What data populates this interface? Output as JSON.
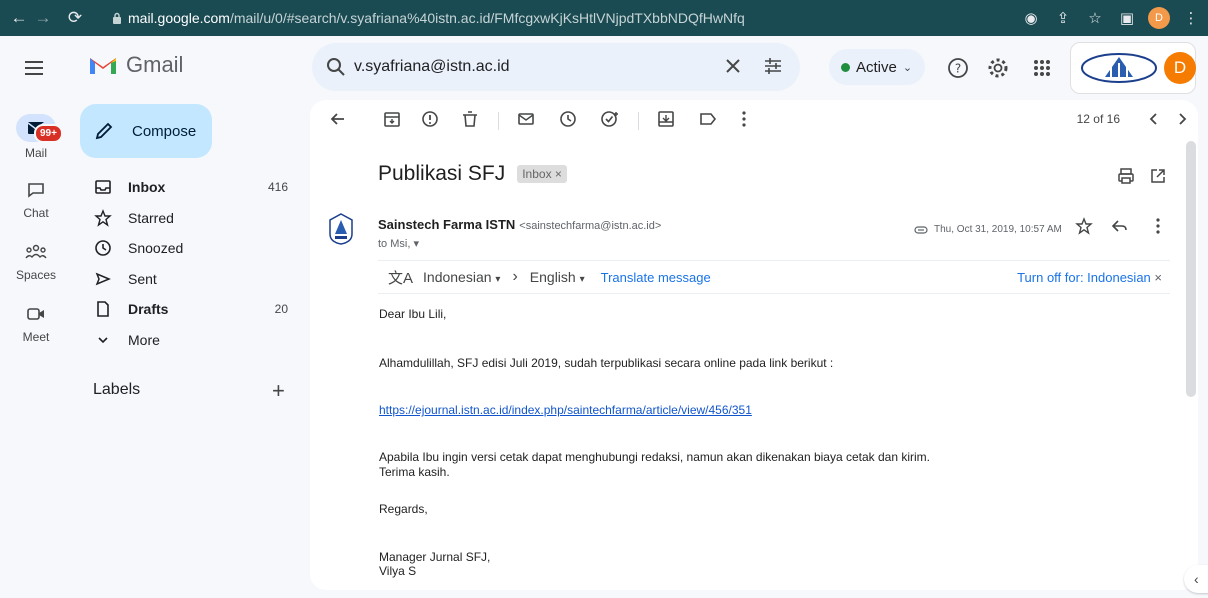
{
  "browser": {
    "url_host": "mail.google.com",
    "url_path": "/mail/u/0/#search/v.syafriana%40istn.ac.id/FMfcgxwKjKsHtlVNjpdTXbbNDQfHwNfq",
    "profile_initial": "D"
  },
  "header": {
    "app_name": "Gmail",
    "search_value": "v.syafriana@istn.ac.id",
    "status_label": "Active",
    "account_initial": "D"
  },
  "rail": {
    "mail_label": "Mail",
    "mail_badge": "99+",
    "chat_label": "Chat",
    "spaces_label": "Spaces",
    "meet_label": "Meet"
  },
  "sidebar": {
    "compose_label": "Compose",
    "items": [
      {
        "label": "Inbox",
        "count": "416"
      },
      {
        "label": "Starred",
        "count": ""
      },
      {
        "label": "Snoozed",
        "count": ""
      },
      {
        "label": "Sent",
        "count": ""
      },
      {
        "label": "Drafts",
        "count": "20"
      },
      {
        "label": "More",
        "count": ""
      }
    ],
    "labels_heading": "Labels"
  },
  "toolbar": {
    "pager": "12 of 16"
  },
  "email": {
    "subject": "Publikasi SFJ",
    "label_chip": "Inbox",
    "sender_name": "Sainstech Farma ISTN",
    "sender_email": "<sainstechfarma@istn.ac.id>",
    "to_line": "to Msi,",
    "date": "Thu, Oct 31, 2019, 10:57 AM",
    "translate": {
      "from_lang": "Indonesian",
      "to_lang": "English",
      "action": "Translate message",
      "turn_off": "Turn off for: Indonesian"
    },
    "body": {
      "greeting": "Dear Ibu Lili,",
      "line1": "Alhamdulillah, SFJ edisi Juli 2019, sudah terpublikasi secara online pada link berikut :",
      "link": "https://ejournal.istn.ac.id/index.php/saintechfarma/article/view/456/351",
      "line2": "Apabila Ibu ingin versi cetak dapat menghubungi redaksi, namun akan dikenakan biaya cetak dan kirim.",
      "line3": "Terima kasih.",
      "regards": "Regards,",
      "sig1": "Manager Jurnal SFJ,",
      "sig2": "Vilya S"
    }
  }
}
